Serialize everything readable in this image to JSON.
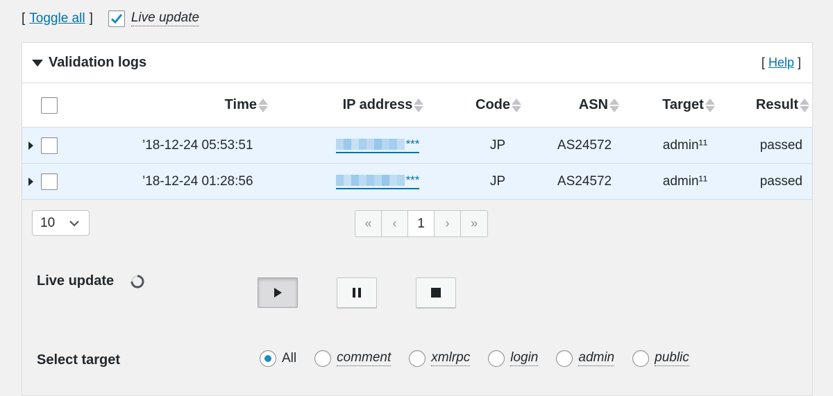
{
  "toolbar": {
    "bracket_open": "[",
    "toggle_all": "Toggle all",
    "bracket_close": "]",
    "live_update_checked": true,
    "live_update_label": "Live update"
  },
  "panel": {
    "title": "Validation logs",
    "help_open": "[",
    "help_label": "Help",
    "help_close": "]"
  },
  "table": {
    "columns": [
      "Time",
      "IP address",
      "Code",
      "ASN",
      "Target",
      "Result"
    ],
    "rows": [
      {
        "time": "’18-12-24 05:53:51",
        "ip_suffix": "***",
        "code": "JP",
        "asn": "AS24572",
        "target": "admin¹¹",
        "result": "passed"
      },
      {
        "time": "’18-12-24 01:28:56",
        "ip_suffix": "***",
        "code": "JP",
        "asn": "AS24572",
        "target": "admin¹¹",
        "result": "passed"
      }
    ]
  },
  "footer": {
    "per_page": "10",
    "pager": {
      "first": "«",
      "prev": "‹",
      "current": "1",
      "next": "›",
      "last": "»"
    }
  },
  "live_update": {
    "label": "Live update",
    "active_control": "play"
  },
  "select_target": {
    "label": "Select target",
    "selected": "All",
    "options": [
      "All",
      "comment",
      "xmlrpc",
      "login",
      "admin",
      "public"
    ]
  },
  "colors": {
    "link": "#0073aa",
    "row_highlight": "#e9f4fe",
    "radio_selected": "#1e8cbe"
  }
}
